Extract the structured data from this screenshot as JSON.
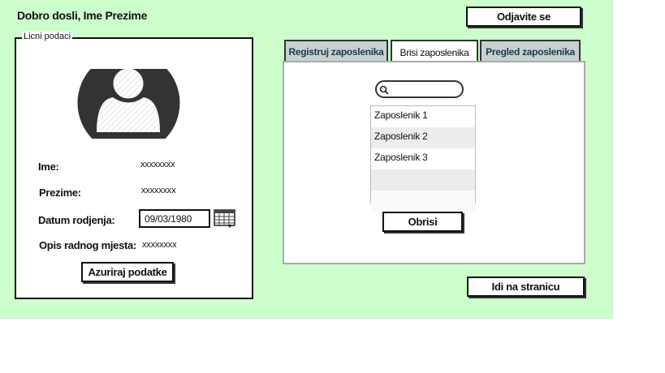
{
  "header": {
    "greeting": "Dobro dosli, Ime Prezime",
    "logout_label": "Odjavite se"
  },
  "profile_panel": {
    "legend": "Licni podaci",
    "avatar_icon": "user-avatar-icon",
    "fields": {
      "ime_label": "Ime:",
      "ime_value": "xxxxxxxx",
      "prezime_label": "Prezime:",
      "prezime_value": "xxxxxxxx",
      "datum_label": "Datum rodjenja:",
      "datum_value": "09/03/1980",
      "opis_label": "Opis radnog mjesta:",
      "opis_value": "xxxxxxxx"
    },
    "calendar_icon": "calendar-icon",
    "update_label": "Azuriraj podatke"
  },
  "tabs": [
    {
      "label": "Registruj zaposlenika",
      "active": false
    },
    {
      "label": "Brisi zaposlenika",
      "active": true
    },
    {
      "label": "Pregled zaposlenika",
      "active": false
    }
  ],
  "delete_tab": {
    "search": {
      "placeholder": "",
      "icon": "search-icon"
    },
    "employees": [
      "Zaposlenik 1",
      "Zaposlenik 2",
      "Zaposlenik 3",
      "",
      ""
    ],
    "delete_label": "Obrisi"
  },
  "footer": {
    "goto_label": "Idi na stranicu"
  },
  "colors": {
    "background": "#ccffcc",
    "inactive_tab": "#c8d0d0",
    "tab_text": "#1d3b4a"
  }
}
